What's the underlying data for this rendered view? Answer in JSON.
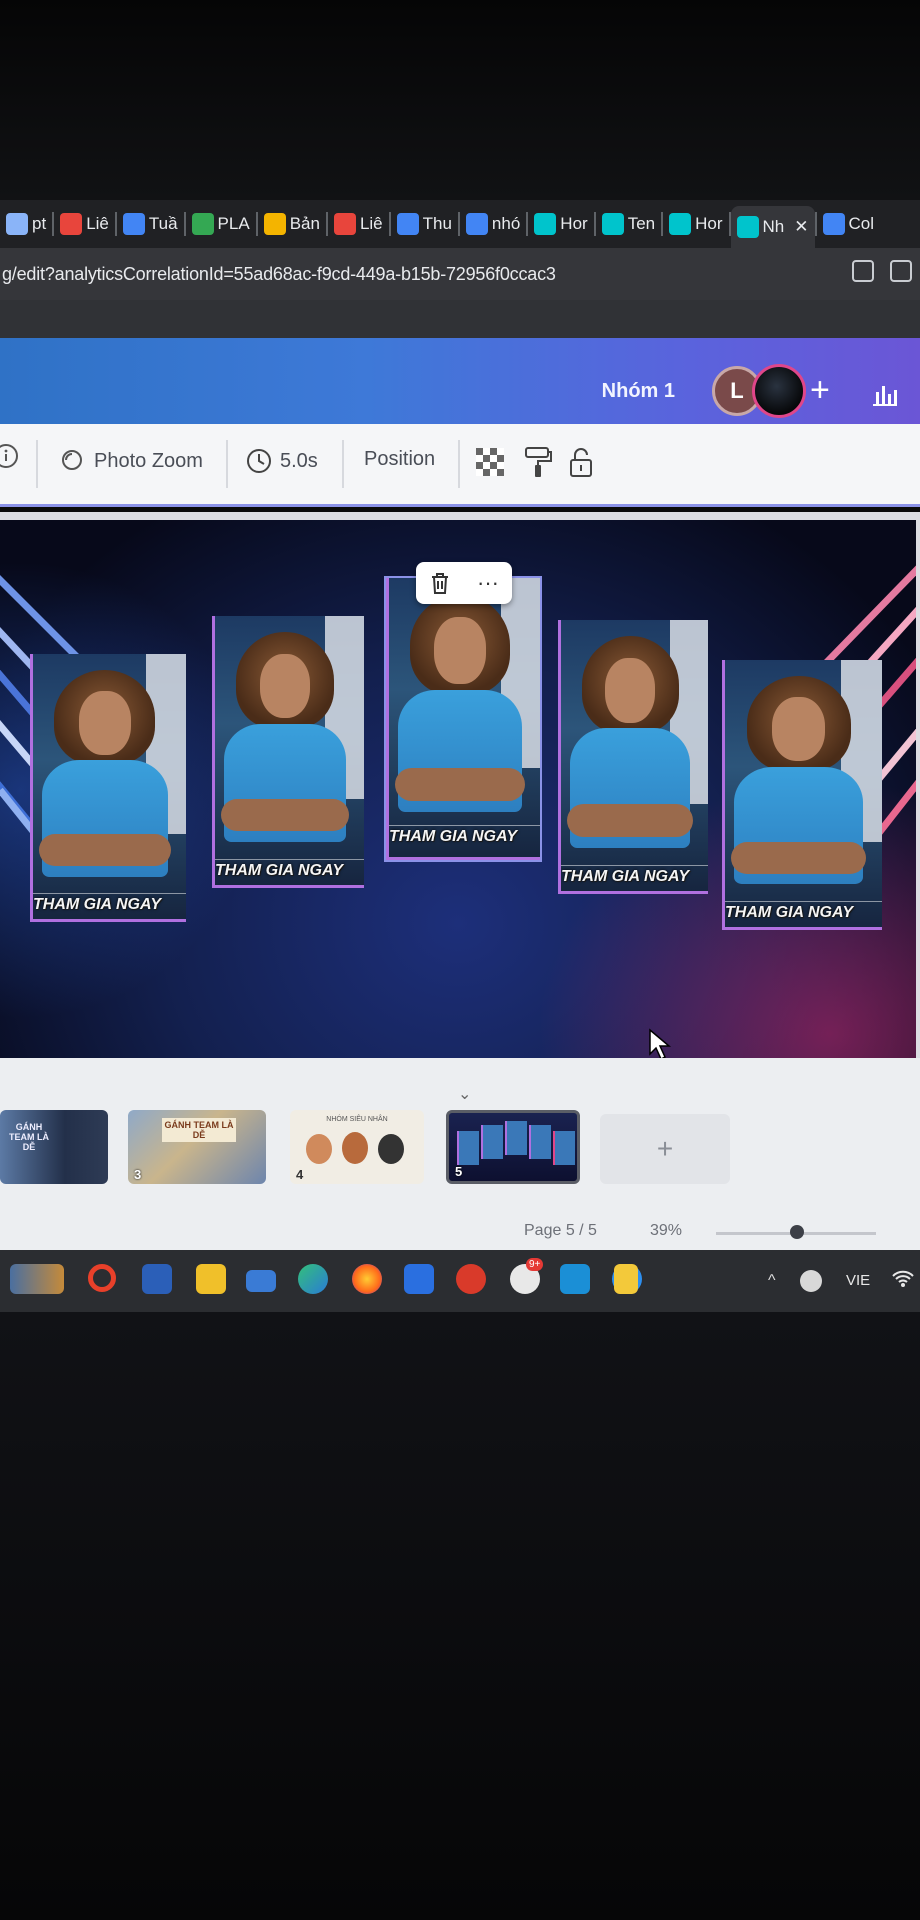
{
  "browser": {
    "tabs": [
      {
        "label": "pt",
        "icon": "doc-icon",
        "color": "#8ab4f8"
      },
      {
        "label": "Liê",
        "icon": "flower-icon",
        "color": "#e8453c"
      },
      {
        "label": "Tuầ",
        "icon": "drive-icon",
        "color": "#4285f4"
      },
      {
        "label": "PLA",
        "icon": "sheets-icon",
        "color": "#34a853"
      },
      {
        "label": "Bản",
        "icon": "slides-icon",
        "color": "#f4b400"
      },
      {
        "label": "Liê",
        "icon": "flower-icon",
        "color": "#e8453c"
      },
      {
        "label": "Thu",
        "icon": "drive-icon",
        "color": "#4285f4"
      },
      {
        "label": "nhó",
        "icon": "docs-icon",
        "color": "#4285f4"
      },
      {
        "label": "Hor",
        "icon": "canva-icon",
        "color": "#00c4cc"
      },
      {
        "label": "Ten",
        "icon": "canva-icon",
        "color": "#00c4cc"
      },
      {
        "label": "Hor",
        "icon": "canva-icon",
        "color": "#00c4cc"
      },
      {
        "label": "Nh",
        "icon": "canva-icon",
        "color": "#00c4cc",
        "active": true
      },
      {
        "label": "Col",
        "icon": "heart-icon",
        "color": "#4285f4"
      }
    ],
    "url": "g/edit?analyticsCorrelationId=55ad68ac-f9cd-449a-b15b-72956f0ccac3"
  },
  "header": {
    "group_name": "Nhóm 1",
    "avatar_initial": "L",
    "add_label": "+"
  },
  "toolbar": {
    "photo_zoom": "Photo Zoom",
    "duration": "5.0s",
    "position": "Position"
  },
  "design": {
    "cta_text": "THAM GIA NGAY",
    "floating_menu_more": "···"
  },
  "pages": {
    "thumbs": [
      {
        "number": "",
        "title": "GÁNH TEAM LÀ DỄ"
      },
      {
        "number": "3",
        "title": "GÁNH TEAM LÀ DỄ"
      },
      {
        "number": "4",
        "title": "NHÓM SIÊU NHÂN"
      },
      {
        "number": "5",
        "title": ""
      }
    ],
    "add_label": "+",
    "indicator": "Page 5 / 5",
    "zoom": "39%",
    "zoom_level": 0.39
  },
  "taskbar": {
    "language": "VIE",
    "badge": "9+"
  },
  "colors": {
    "header_blue": "#3e79d8",
    "header_purple": "#6b56d6",
    "selection": "#8b92e8",
    "canva": "#00c4cc"
  }
}
